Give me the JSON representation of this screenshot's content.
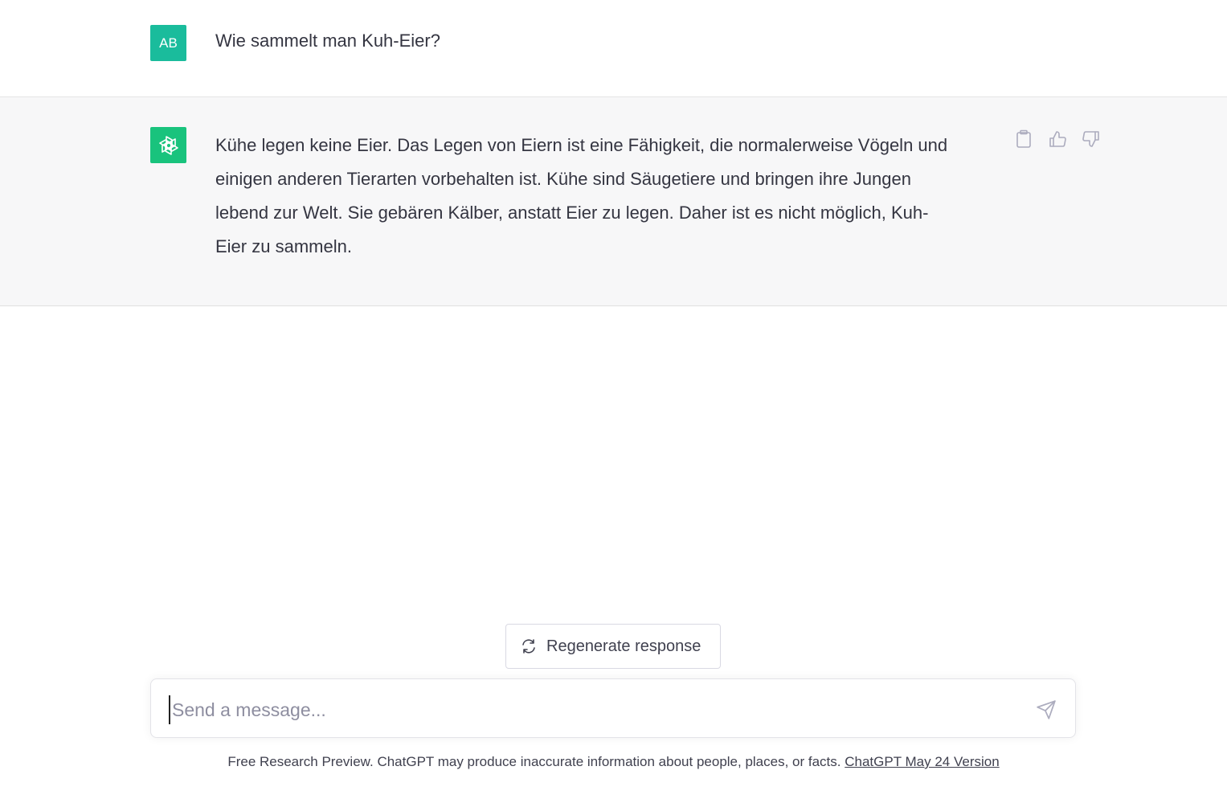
{
  "user_message": {
    "avatar_initials": "AB",
    "text": "Wie sammelt man Kuh-Eier?"
  },
  "assistant_message": {
    "avatar_icon": "openai-logo-icon",
    "text": "Kühe legen keine Eier. Das Legen von Eiern ist eine Fähigkeit, die normalerweise Vögeln und\neinigen anderen Tierarten vorbehalten ist. Kühe sind Säugetiere und bringen ihre Jungen\nlebend zur Welt. Sie gebären Kälber, anstatt Eier zu legen. Daher ist es nicht möglich, Kuh-\nEier zu sammeln.",
    "actions": [
      "copy-icon",
      "thumbs-up-icon",
      "thumbs-down-icon"
    ]
  },
  "regenerate": {
    "label": "Regenerate response",
    "icon": "refresh-icon"
  },
  "composer": {
    "placeholder": "Send a message...",
    "value": "",
    "send_icon": "send-icon"
  },
  "footer": {
    "text": "Free Research Preview. ChatGPT may produce inaccurate information about people, places, or facts.",
    "link": "ChatGPT May 24 Version"
  },
  "colors": {
    "accent": "#19c37d",
    "assistant_bg": "#f7f7f8",
    "text": "#343541"
  }
}
